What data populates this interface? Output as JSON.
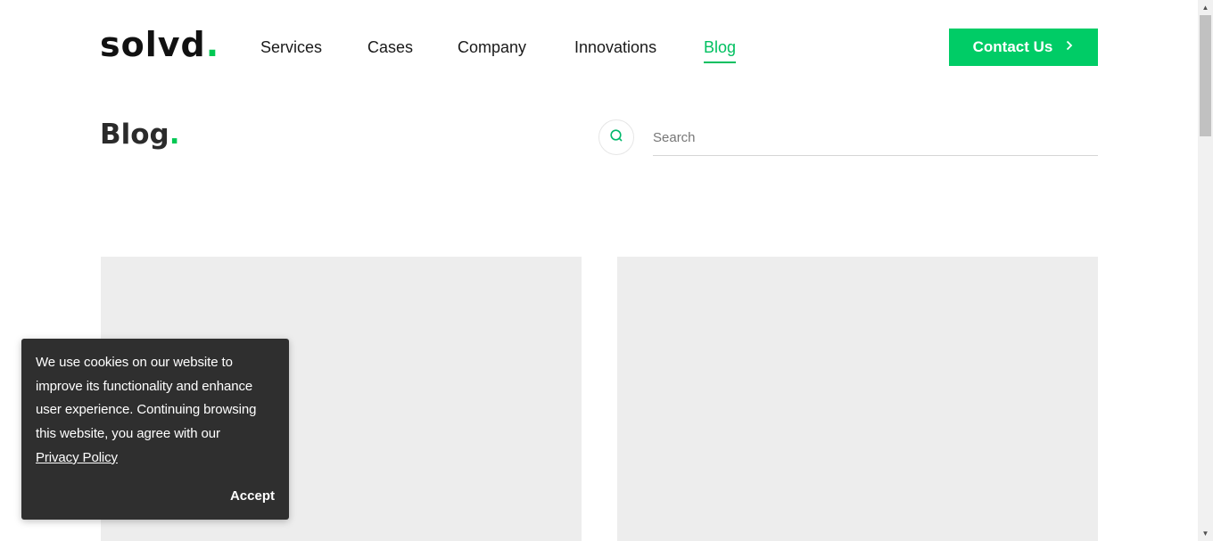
{
  "header": {
    "logo_text": "solvd",
    "logo_dot": ".",
    "nav": [
      {
        "label": "Services"
      },
      {
        "label": "Cases"
      },
      {
        "label": "Company"
      },
      {
        "label": "Innovations"
      },
      {
        "label": "Blog",
        "active": true
      }
    ],
    "contact_label": "Contact Us",
    "contact_icon": "chevron-right-icon"
  },
  "main": {
    "title": "Blog",
    "title_dot": ".",
    "search": {
      "placeholder": "Search",
      "value": "",
      "icon": "search-icon"
    }
  },
  "cookie_banner": {
    "text": "We use cookies on our website to improve its functionality and enhance user experience. Continuing browsing this website, you agree with our",
    "link_label": "Privacy Policy",
    "accept_label": "Accept"
  },
  "colors": {
    "accent": "#00cc66",
    "active_nav": "#00c060",
    "cookie_bg": "#2f2f2f",
    "placeholder_card": "#ededed"
  }
}
